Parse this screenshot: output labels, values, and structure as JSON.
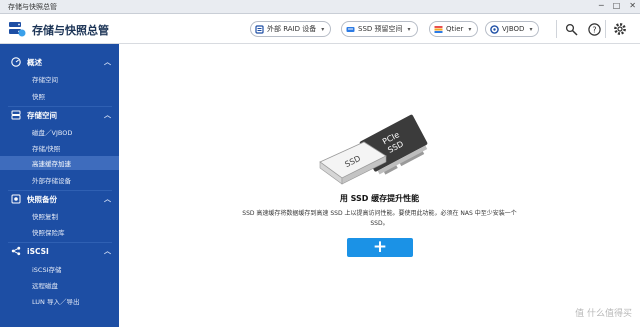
{
  "window": {
    "title": "存储与快照总管"
  },
  "header": {
    "title": "存储与快照总管",
    "buttons": [
      {
        "label": "外部 RAID 设备",
        "icon": "external-raid-icon"
      },
      {
        "label": "SSD 预留空间",
        "icon": "ssd-icon"
      },
      {
        "label": "Qtier",
        "icon": "qtier-icon"
      },
      {
        "label": "VJBOD",
        "icon": "vjbod-icon"
      }
    ],
    "tools": [
      "gear-search-icon",
      "help-icon",
      "settings-icon"
    ]
  },
  "sidebar": {
    "sections": [
      {
        "label": "概述",
        "icon": "overview-icon",
        "items": [
          "存储空间",
          "快照"
        ]
      },
      {
        "label": "存储空间",
        "icon": "storage-icon",
        "items": [
          "磁盘／VJBOD",
          "存储/快照",
          "高速缓存加速",
          "外部存储设备"
        ]
      },
      {
        "label": "快照备份",
        "icon": "snapshot-backup-icon",
        "items": [
          "快照复制",
          "快照保险库"
        ]
      },
      {
        "label": "iSCSI",
        "icon": "iscsi-icon",
        "items": [
          "iSCSI存储",
          "远程磁盘",
          "LUN 导入／导出"
        ]
      }
    ],
    "active_item": "高速缓存加速"
  },
  "main": {
    "illustration_labels": {
      "ssd": "SSD",
      "pcie_line1": "PCIe",
      "pcie_line2": "SSD"
    },
    "heading": "用 SSD 缓存提升性能",
    "description": "SSD 高速缓存将数据缓存到高速 SSD 上以提高访问性能。要使用此功能，必须在 NAS 中至少安装一个 SSD。",
    "add_button_label": "+"
  },
  "watermark": "值 什么值得买",
  "colors": {
    "sidebar": "#1d4ea4",
    "sidebar_active": "#3e6cbd",
    "accent": "#1b92e6"
  }
}
